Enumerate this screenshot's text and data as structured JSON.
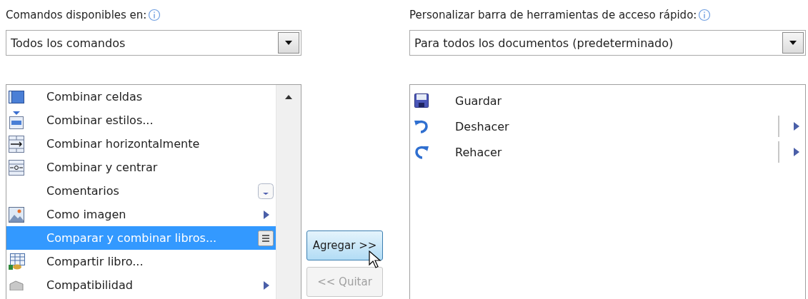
{
  "left": {
    "label": "Comandos disponibles en:",
    "dropdown": {
      "value": "Todos los comandos"
    },
    "commands": [
      {
        "label": "Combinar celdas",
        "kind": "plain",
        "selected": false
      },
      {
        "label": "Combinar estilos...",
        "kind": "plain",
        "selected": false
      },
      {
        "label": "Combinar horizontalmente",
        "kind": "plain",
        "selected": false
      },
      {
        "label": "Combinar y centrar",
        "kind": "plain",
        "selected": false
      },
      {
        "label": "Comentarios",
        "kind": "dropdown",
        "selected": false
      },
      {
        "label": "Como imagen",
        "kind": "submenu",
        "selected": false
      },
      {
        "label": "Comparar y combinar libros...",
        "kind": "gallery",
        "selected": true
      },
      {
        "label": "Compartir libro...",
        "kind": "plain",
        "selected": false
      },
      {
        "label": "Compatibilidad",
        "kind": "submenu",
        "selected": false
      }
    ]
  },
  "buttons": [
    {
      "label": "Agregar >>",
      "disabled": false
    },
    {
      "label": "<< Quitar",
      "disabled": true
    }
  ],
  "right": {
    "label": "Personalizar barra de herramientas de acceso rápido:",
    "dropdown": {
      "value": "Para todos los documentos (predeterminado)"
    },
    "commands": [
      {
        "label": "Guardar",
        "kind": "plain"
      },
      {
        "label": "Deshacer",
        "kind": "submenu"
      },
      {
        "label": "Rehacer",
        "kind": "submenu"
      }
    ]
  }
}
